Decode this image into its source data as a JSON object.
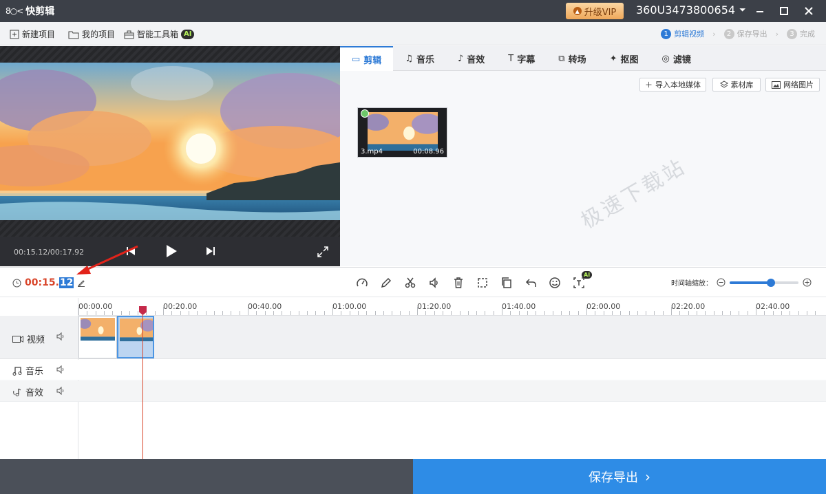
{
  "app": {
    "title": "快剪辑",
    "logo_mark": "8○<",
    "vip_label": "升级VIP",
    "user": "360U3473800654"
  },
  "toolbar": {
    "new_project": "新建项目",
    "my_projects": "我的项目",
    "smart_tools": "智能工具箱",
    "ai_badge": "AI"
  },
  "steps": [
    {
      "num": "1",
      "label": "剪辑视频",
      "active": true
    },
    {
      "num": "2",
      "label": "保存导出",
      "active": false
    },
    {
      "num": "3",
      "label": "完成",
      "active": false
    }
  ],
  "preview": {
    "time_readout": "00:15.12/00:17.92"
  },
  "tabs": [
    {
      "label": "剪辑",
      "icon": "video-camera-icon",
      "glyph": "▭"
    },
    {
      "label": "音乐",
      "icon": "music-note-icon",
      "glyph": "♫"
    },
    {
      "label": "音效",
      "icon": "sound-effect-icon",
      "glyph": "♪"
    },
    {
      "label": "字幕",
      "icon": "text-icon",
      "glyph": "T"
    },
    {
      "label": "转场",
      "icon": "transition-icon",
      "glyph": "⧉"
    },
    {
      "label": "抠图",
      "icon": "magic-wand-icon",
      "glyph": "✦"
    },
    {
      "label": "滤镜",
      "icon": "filter-icon",
      "glyph": "◎"
    }
  ],
  "media_buttons": {
    "import": "导入本地媒体",
    "library": "素材库",
    "web_images": "网络图片"
  },
  "media_item": {
    "name": "3.mp4",
    "duration": "00:08.96"
  },
  "watermark": "极速下载站",
  "edit_bar": {
    "time_main": "00:15.",
    "time_frames": "12"
  },
  "zoom": {
    "label": "时间轴缩放：",
    "level": 0.6
  },
  "ruler": [
    "00:00.00",
    "00:20.00",
    "00:40.00",
    "01:00.00",
    "01:20.00",
    "01:40.00",
    "02:00.00",
    "02:20.00",
    "02:40.00"
  ],
  "tracks": {
    "video": "视频",
    "music": "音乐",
    "sfx": "音效"
  },
  "footer": {
    "save_export": "保存导出"
  },
  "colors": {
    "accent": "#2e8ce6",
    "time_red": "#d9462b",
    "titlebar": "#3c4048"
  }
}
